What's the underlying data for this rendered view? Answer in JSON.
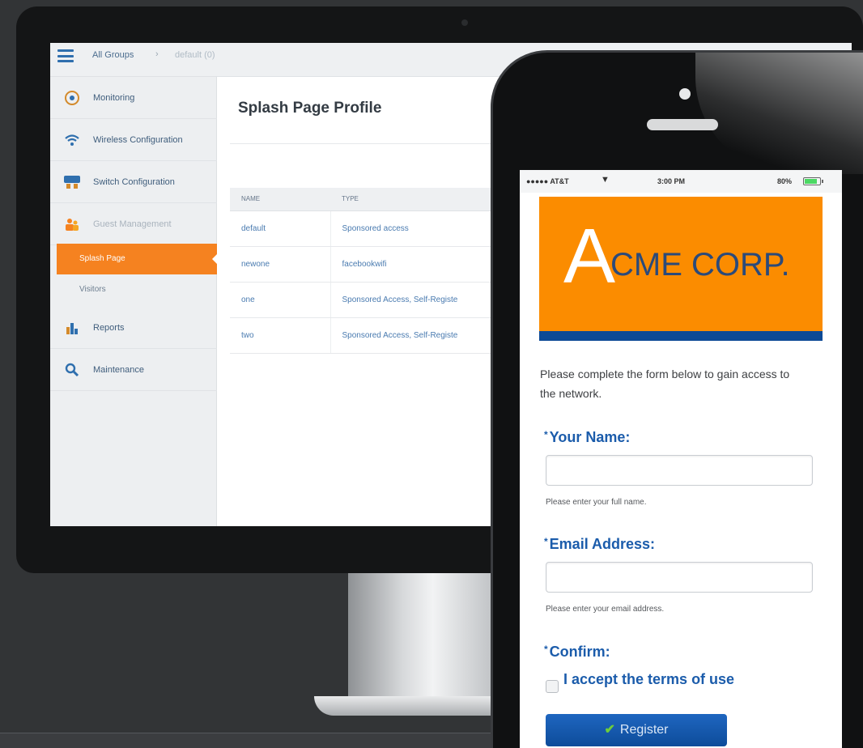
{
  "desktop_app": {
    "breadcrumb": {
      "root": "All Groups",
      "separator": "›",
      "current": "default (0)"
    },
    "sidebar": {
      "items": [
        {
          "label": "Monitoring",
          "icon": "gauge-icon"
        },
        {
          "label": "Wireless Configuration",
          "icon": "wifi-icon"
        },
        {
          "label": "Switch Configuration",
          "icon": "switch-icon"
        },
        {
          "label": "Guest Management",
          "icon": "guest-icon"
        },
        {
          "label": "Reports",
          "icon": "bar-chart-icon"
        },
        {
          "label": "Maintenance",
          "icon": "wrench-icon"
        }
      ],
      "sub_items": [
        {
          "label": "Splash Page",
          "active": true
        },
        {
          "label": "Visitors",
          "active": false
        }
      ]
    },
    "page_title": "Splash Page Profile",
    "table": {
      "columns": [
        "NAME",
        "TYPE"
      ],
      "rows": [
        {
          "name": "default",
          "type": "Sponsored access"
        },
        {
          "name": "newone",
          "type": "facebookwifi"
        },
        {
          "name": "one",
          "type": "Sponsored Access, Self-Registe"
        },
        {
          "name": "two",
          "type": "Sponsored Access, Self-Registe"
        }
      ]
    },
    "accent_color": "#f58220"
  },
  "phone": {
    "status_bar": {
      "carrier": "●●●●● AT&T",
      "time": "3:00 PM",
      "battery": "80%"
    },
    "banner": {
      "logo_letter": "A",
      "logo_rest": "CME CORP.",
      "bg_color": "#fb8c00",
      "stripe_color": "#0d4a96"
    },
    "intro": "Please complete the form below to gain access to the network.",
    "form": {
      "name_label": "Your Name:",
      "name_value": "",
      "name_help": "Please enter your full name.",
      "email_label": "Email Address:",
      "email_value": "",
      "email_help": "Please enter your email address.",
      "confirm_label": "Confirm:",
      "terms_label": "I accept the terms of use",
      "terms_checked": false,
      "required_marker": "*",
      "register_label": "Register"
    },
    "label_color": "#1b5cab"
  }
}
